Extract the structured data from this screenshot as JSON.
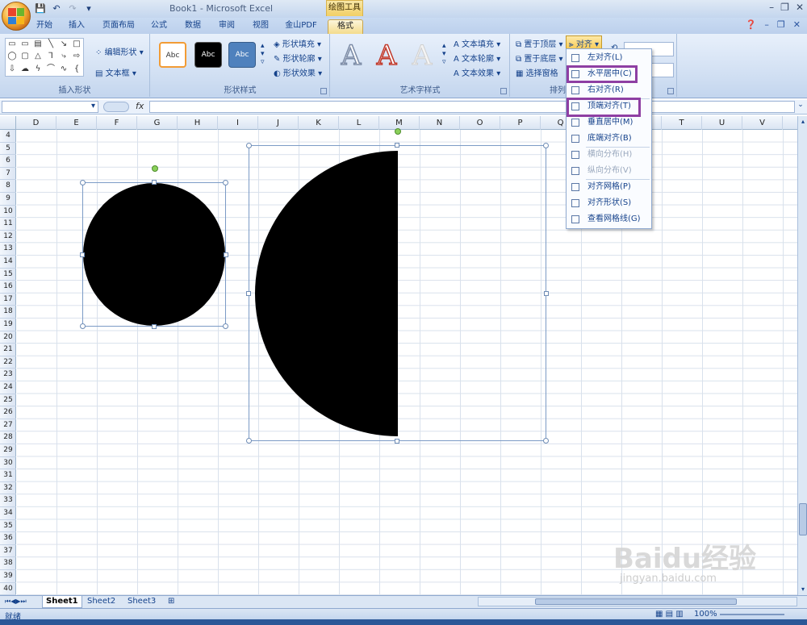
{
  "window": {
    "title": "Book1 - Microsoft Excel",
    "context_tab_group": "绘图工具"
  },
  "qat": {
    "save": "💾",
    "undo": "↶",
    "redo": "↷",
    "customize": "▾"
  },
  "window_controls": {
    "minimize": "–",
    "restore": "❐",
    "close": "✕"
  },
  "tabs": [
    "开始",
    "插入",
    "页面布局",
    "公式",
    "数据",
    "审阅",
    "视图",
    "金山PDF",
    "格式"
  ],
  "active_tab": "格式",
  "ribbon": {
    "insert_shapes": {
      "label": "插入形状",
      "edit_shape": "编辑形状",
      "text_box": "文本框"
    },
    "shape_styles": {
      "label": "形状样式",
      "style_sample": "Abc",
      "fill": "形状填充",
      "outline": "形状轮廓",
      "effects": "形状效果"
    },
    "wordart_styles": {
      "label": "艺术字样式",
      "letter": "A",
      "text_fill": "文本填充",
      "text_outline": "文本轮廓",
      "text_effects": "文本效果"
    },
    "arrange": {
      "label": "排列",
      "bring_front": "置于顶层",
      "send_back": "置于底层",
      "selection_pane": "选择窗格",
      "align": "对齐"
    }
  },
  "formula_bar": {
    "fx": "fx",
    "value": ""
  },
  "columns": [
    "D",
    "E",
    "F",
    "G",
    "H",
    "I",
    "J",
    "K",
    "L",
    "M",
    "N",
    "O",
    "P",
    "Q",
    "R",
    "S",
    "T",
    "U",
    "V"
  ],
  "rows": [
    "4",
    "5",
    "6",
    "7",
    "8",
    "9",
    "10",
    "11",
    "12",
    "13",
    "14",
    "15",
    "16",
    "17",
    "18",
    "19",
    "20",
    "21",
    "22",
    "23",
    "24",
    "25",
    "26",
    "27",
    "28",
    "29",
    "30",
    "31",
    "32",
    "33",
    "34",
    "35",
    "36",
    "37",
    "38",
    "39",
    "40"
  ],
  "align_menu": [
    {
      "label": "左对齐(L)",
      "icon": "align-left-icon",
      "disabled": false
    },
    {
      "label": "水平居中(C)",
      "icon": "align-center-icon",
      "disabled": false
    },
    {
      "label": "右对齐(R)",
      "icon": "align-right-icon",
      "disabled": false
    },
    {
      "label": "顶端对齐(T)",
      "icon": "align-top-icon",
      "disabled": false
    },
    {
      "label": "垂直居中(M)",
      "icon": "align-middle-icon",
      "disabled": false
    },
    {
      "label": "底端对齐(B)",
      "icon": "align-bottom-icon",
      "disabled": false
    },
    {
      "label": "横向分布(H)",
      "icon": "distribute-horizontal-icon",
      "disabled": true
    },
    {
      "label": "纵向分布(V)",
      "icon": "distribute-vertical-icon",
      "disabled": true
    },
    {
      "label": "对齐网格(P)",
      "icon": "snap-grid-icon",
      "disabled": false
    },
    {
      "label": "对齐形状(S)",
      "icon": "snap-shape-icon",
      "disabled": false
    },
    {
      "label": "查看网格线(G)",
      "icon": "view-gridlines-icon",
      "disabled": false
    }
  ],
  "sheets": [
    "Sheet1",
    "Sheet2",
    "Sheet3"
  ],
  "active_sheet": "Sheet1",
  "status": {
    "ready": "就绪",
    "zoom": "100%"
  },
  "watermark": {
    "brand": "Baidu经验",
    "url": "jingyan.baidu.com"
  },
  "colors": {
    "highlight": "#8e3fa3",
    "ribbon_blue": "#15428b",
    "shape_fill": "#000000"
  }
}
